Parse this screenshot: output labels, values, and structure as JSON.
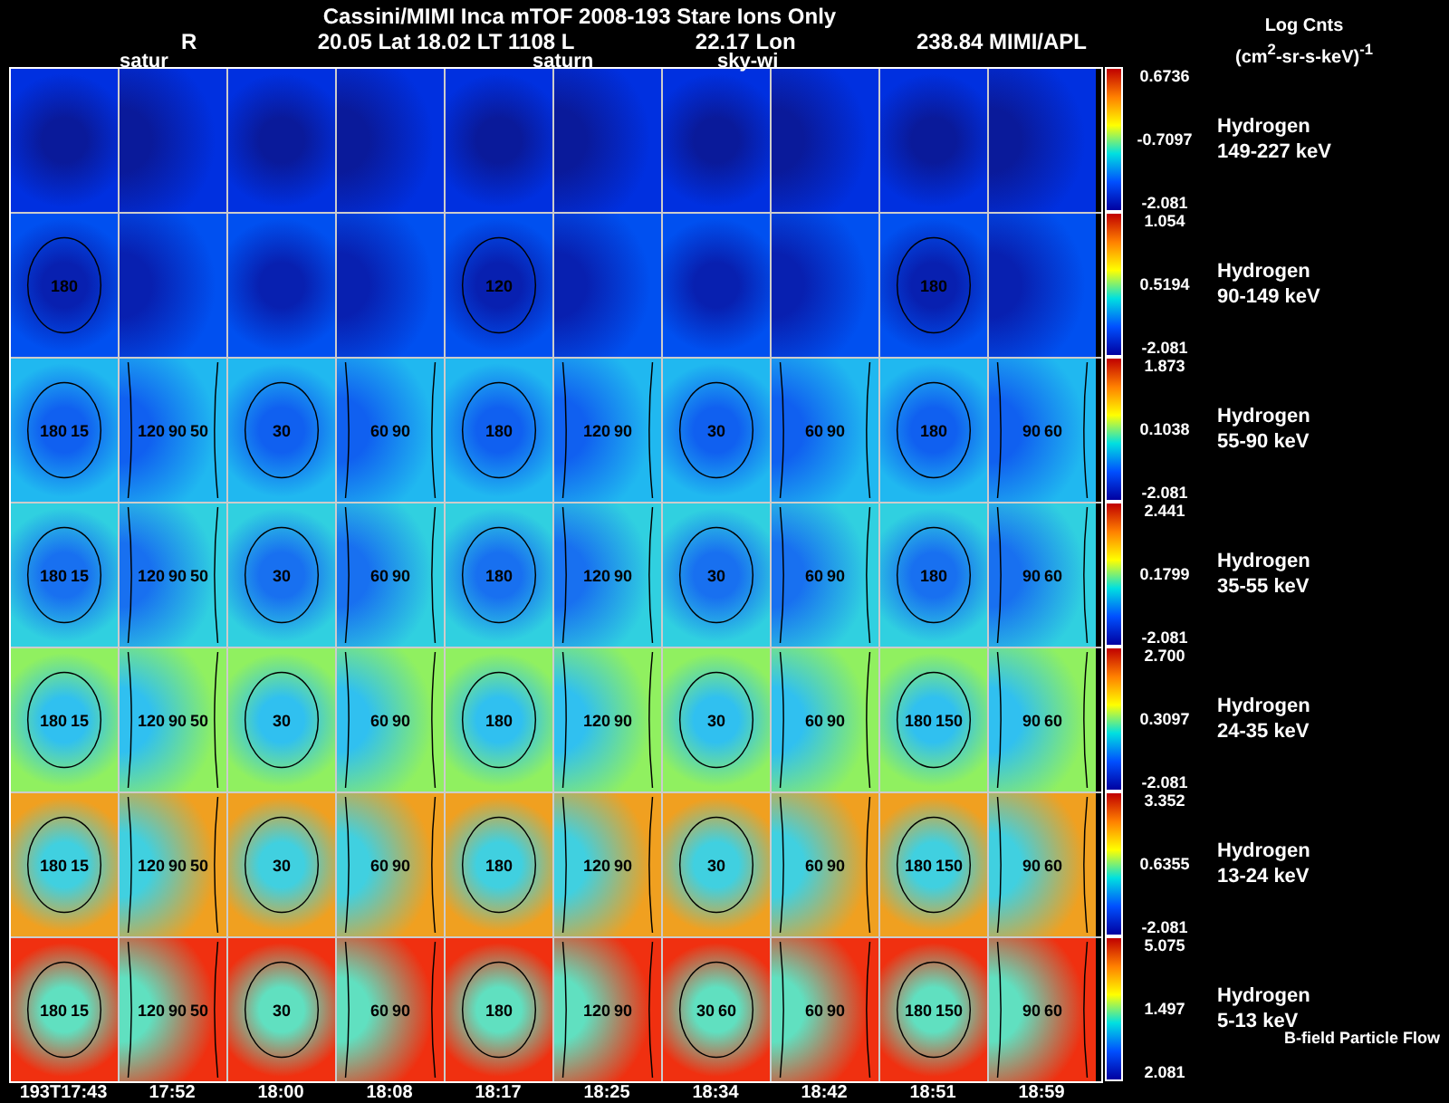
{
  "title": "Cassini/MIMI Inca mTOF  2008-193   Stare   Ions Only",
  "header": [
    "R",
    "20.05 Lat 18.02 LT 1108 L",
    "22.17 Lon",
    "238.84  MIMI/APL"
  ],
  "units": {
    "title": "Log Cnts",
    "unit": "(cm$^{2}$-sr-s-keV)$^{-1}$"
  },
  "overlays": [
    "satur",
    "saturn",
    "sky-wi"
  ],
  "rows": [
    {
      "species": "Hydrogen",
      "energy": "149-227 keV",
      "max": "0.6736",
      "mid": "-0.7097",
      "min": "-2.081"
    },
    {
      "species": "Hydrogen",
      "energy": "90-149 keV",
      "max": "1.054",
      "mid": "0.5194",
      "min": "-2.081",
      "sparse_contours": [
        "180",
        "120",
        "180"
      ]
    },
    {
      "species": "Hydrogen",
      "energy": "55-90 keV",
      "max": "1.873",
      "mid": "0.1038",
      "min": "-2.081",
      "contours": [
        [
          "180",
          "15"
        ],
        [
          "120",
          "90",
          "50"
        ],
        [
          "30"
        ],
        [
          "60",
          "90"
        ],
        [
          "180"
        ],
        [
          "120",
          "90"
        ],
        [
          "30"
        ],
        [
          "60",
          "90"
        ],
        [
          "180"
        ],
        [
          "90",
          "60"
        ]
      ]
    },
    {
      "species": "Hydrogen",
      "energy": "35-55 keV",
      "max": "2.441",
      "mid": "0.1799",
      "min": "-2.081",
      "contours": [
        [
          "180",
          "15"
        ],
        [
          "120",
          "90",
          "50"
        ],
        [
          "30"
        ],
        [
          "60",
          "90"
        ],
        [
          "180"
        ],
        [
          "120",
          "90"
        ],
        [
          "30"
        ],
        [
          "60",
          "90"
        ],
        [
          "180"
        ],
        [
          "90",
          "60"
        ]
      ]
    },
    {
      "species": "Hydrogen",
      "energy": "24-35 keV",
      "max": "2.700",
      "mid": "0.3097",
      "min": "-2.081",
      "contours": [
        [
          "180",
          "15"
        ],
        [
          "120",
          "90",
          "50"
        ],
        [
          "30"
        ],
        [
          "60",
          "90"
        ],
        [
          "180"
        ],
        [
          "120",
          "90"
        ],
        [
          "30"
        ],
        [
          "60",
          "90"
        ],
        [
          "180",
          "150"
        ],
        [
          "90",
          "60"
        ]
      ]
    },
    {
      "species": "Hydrogen",
      "energy": "13-24 keV",
      "max": "3.352",
      "mid": "0.6355",
      "min": "-2.081",
      "contours": [
        [
          "180",
          "15"
        ],
        [
          "120",
          "90",
          "50"
        ],
        [
          "30"
        ],
        [
          "60",
          "90"
        ],
        [
          "180"
        ],
        [
          "120",
          "90"
        ],
        [
          "30"
        ],
        [
          "60",
          "90"
        ],
        [
          "180",
          "150"
        ],
        [
          "90",
          "60"
        ]
      ]
    },
    {
      "species": "Hydrogen",
      "energy": "5-13 keV",
      "max": "5.075",
      "mid": "1.497",
      "min": "2.081",
      "contours": [
        [
          "180",
          "15"
        ],
        [
          "120",
          "90",
          "50"
        ],
        [
          "30"
        ],
        [
          "60",
          "90"
        ],
        [
          "180"
        ],
        [
          "120",
          "90"
        ],
        [
          "30",
          "60"
        ],
        [
          "60",
          "90"
        ],
        [
          "180",
          "150"
        ],
        [
          "90",
          "60"
        ]
      ]
    }
  ],
  "legend": "B-field Particle Flow",
  "times": [
    "193T17:43",
    "17:52",
    "18:00",
    "18:08",
    "18:17",
    "18:25",
    "18:34",
    "18:42",
    "18:51",
    "18:59"
  ]
}
